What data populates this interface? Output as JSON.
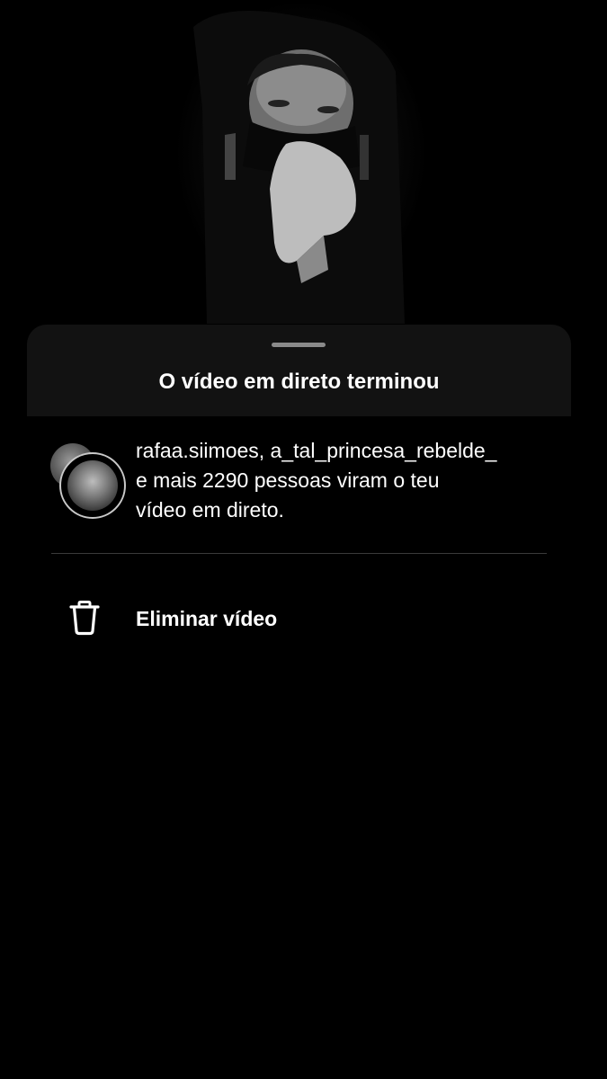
{
  "background": {
    "icon": "live-video-photo"
  },
  "sheet": {
    "title": "O vídeo em direto terminou",
    "viewers": {
      "names": "rafaa.siimoes, a_tal_princesa_rebelde_",
      "summary_line1": "e mais 2290 pessoas viram o teu",
      "summary_line2": "vídeo em direto."
    },
    "delete_action": {
      "icon": "trash-icon",
      "label": "Eliminar vídeo"
    }
  },
  "colors": {
    "background": "#000000",
    "sheet_header": "#121212",
    "text": "#ffffff",
    "divider": "#3a3a3a"
  }
}
